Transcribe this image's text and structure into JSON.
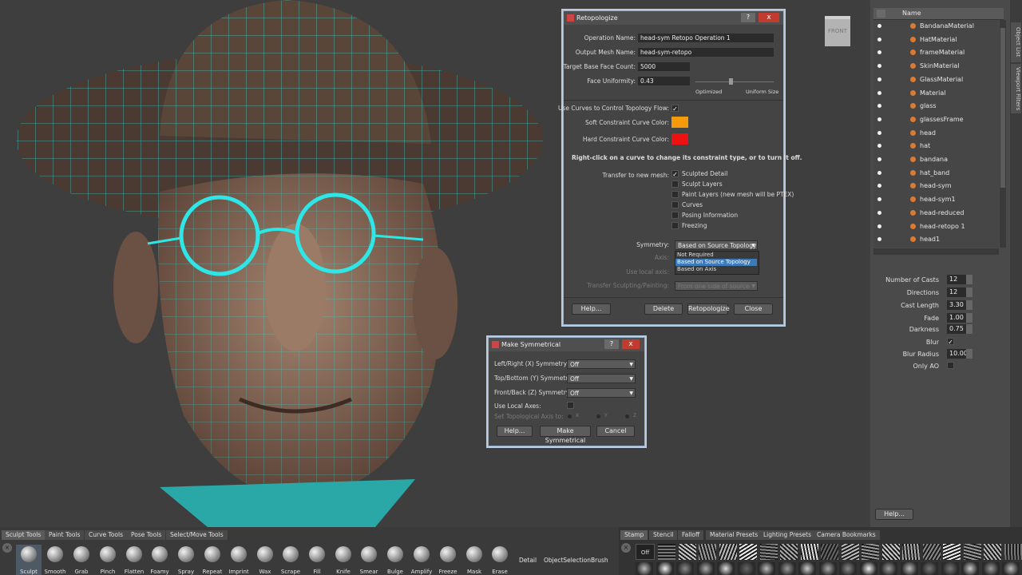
{
  "viewport": {
    "view_cube_label": "FRONT"
  },
  "retopologize": {
    "title": "Retopologize",
    "help_glyph": "?",
    "close_glyph": "x",
    "operation_name_label": "Operation Name:",
    "operation_name": "head-sym Retopo Operation 1",
    "output_mesh_label": "Output Mesh Name:",
    "output_mesh": "head-sym-retopo",
    "target_face_label": "Target Base Face Count:",
    "target_face": "5000",
    "uniformity_label": "Face Uniformity:",
    "uniformity": "0.43",
    "uniformity_slider_fraction": 0.43,
    "optimized_label": "Optimized",
    "uniform_label": "Uniform Size",
    "use_curves_label": "Use Curves to Control Topology Flow:",
    "soft_color_label": "Soft Constraint Curve Color:",
    "soft_color": "#f59a0b",
    "hard_color_label": "Hard Constraint Curve Color:",
    "hard_color": "#ee1111",
    "hint": "Right-click on a curve to change its constraint type, or to turn it off.",
    "transfer_label": "Transfer to new mesh:",
    "transfer_options": [
      "Sculpted Detail",
      "Sculpt Layers",
      "Paint Layers (new mesh will be PTEX)",
      "Curves",
      "Posing Information",
      "Freezing"
    ],
    "symmetry_label": "Symmetry:",
    "symmetry_value": "Based on Source Topology",
    "symmetry_options": [
      "Not Required",
      "Based on Source Topology",
      "Based on Axis"
    ],
    "axis_label": "Axis:",
    "use_local_label": "Use local axis:",
    "transfer_sculpt_label": "Transfer Sculpting/Painting:",
    "transfer_sculpt_value": "From one side of source",
    "buttons": [
      "Help...",
      "Delete",
      "Retopologize",
      "Close"
    ]
  },
  "make_symmetrical": {
    "title": "Make Symmetrical",
    "help_glyph": "?",
    "close_glyph": "x",
    "rows": [
      {
        "label": "Left/Right (X) Symmetry:",
        "value": "Off"
      },
      {
        "label": "Top/Bottom (Y) Symmetry:",
        "value": "Off"
      },
      {
        "label": "Front/Back (Z) Symmetry:",
        "value": "Off"
      }
    ],
    "local_axes_label": "Use Local Axes:",
    "topo_axis_label": "Set Topological Axis to:",
    "axes": [
      "X",
      "Y",
      "Z"
    ],
    "buttons": [
      "Help...",
      "Make Symmetrical",
      "Cancel"
    ]
  },
  "outliner": {
    "header": "Name",
    "items": [
      "BandanaMaterial",
      "HatMaterial",
      "frameMaterial",
      "SkinMaterial",
      "GlassMaterial",
      "Material",
      "glass",
      "glassesFrame",
      "head",
      "hat",
      "bandana",
      "hat_band",
      "head-sym",
      "head-sym1",
      "head-reduced",
      "head-retopo 1",
      "head1"
    ]
  },
  "side_tabs": [
    "Object List",
    "Viewport Filters"
  ],
  "ao_props": [
    {
      "label": "Number of Casts",
      "value": "12"
    },
    {
      "label": "Directions",
      "value": "12"
    },
    {
      "label": "Cast Length",
      "value": "3.30"
    },
    {
      "label": "Fade",
      "value": "1.00"
    },
    {
      "label": "Darkness",
      "value": "0.75"
    },
    {
      "label": "Blur",
      "value": "✓"
    },
    {
      "label": "Blur Radius",
      "value": "10.00"
    },
    {
      "label": "Only AO",
      "value": ""
    }
  ],
  "right_help_button": "Help...",
  "bottom_tabs": [
    "Sculpt Tools",
    "Paint Tools",
    "Curve Tools",
    "Pose Tools",
    "Select/Move Tools"
  ],
  "tools": [
    "Sculpt",
    "Smooth",
    "Grab",
    "Pinch",
    "Flatten",
    "Foamy",
    "Spray",
    "Repeat",
    "Imprint",
    "Wax",
    "Scrape",
    "Fill",
    "Knife",
    "Smear",
    "Bulge",
    "Amplify",
    "Freeze",
    "Mask",
    "Erase"
  ],
  "tool_extra": [
    "Detail",
    "ObjectSelectionBrush"
  ],
  "stamp_tabs": [
    "Stamp",
    "Stencil",
    "Falloff",
    "Material Presets",
    "Lighting Presets",
    "Camera Bookmarks"
  ],
  "stamp_off": "Off",
  "colors": {
    "wireframe": "#2ee6e6",
    "skin": "#8a6a5a",
    "background": "#3e3e3e"
  }
}
